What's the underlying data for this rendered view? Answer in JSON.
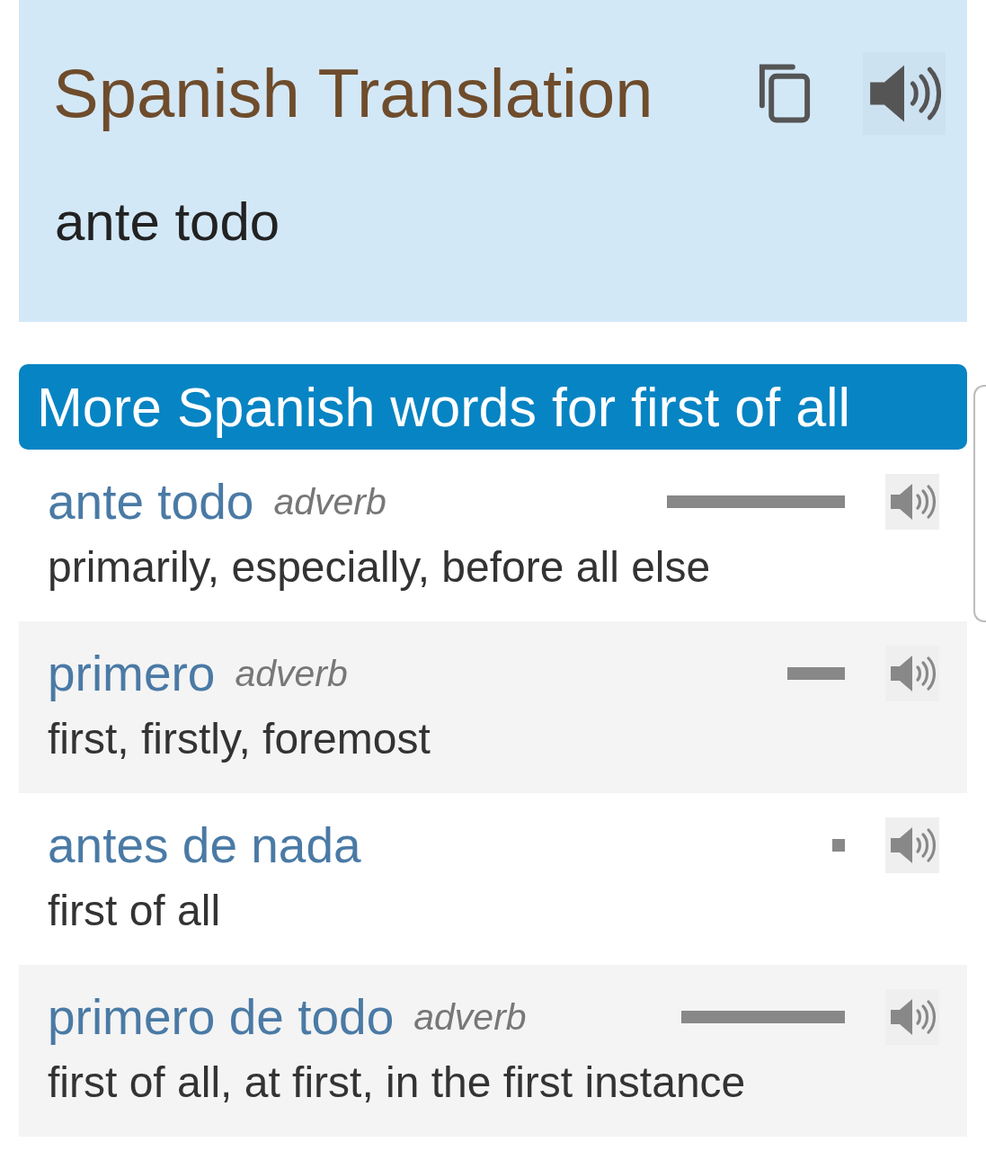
{
  "header": {
    "title": "Spanish Translation",
    "translation": "ante todo"
  },
  "more_words": {
    "heading": "More Spanish words for first of all",
    "entries": [
      {
        "word": "ante todo",
        "part_of_speech": "adverb",
        "level": 0.99,
        "definition": "primarily, especially, before all else"
      },
      {
        "word": "primero",
        "part_of_speech": "adverb",
        "level": 0.32,
        "definition": "first, firstly, foremost"
      },
      {
        "word": "antes de nada",
        "level": 0.07,
        "definition": "first of all"
      },
      {
        "word": "primero de todo",
        "part_of_speech": "adverb",
        "level": 0.91,
        "definition": "first of all, at first, in the first instance"
      }
    ]
  }
}
